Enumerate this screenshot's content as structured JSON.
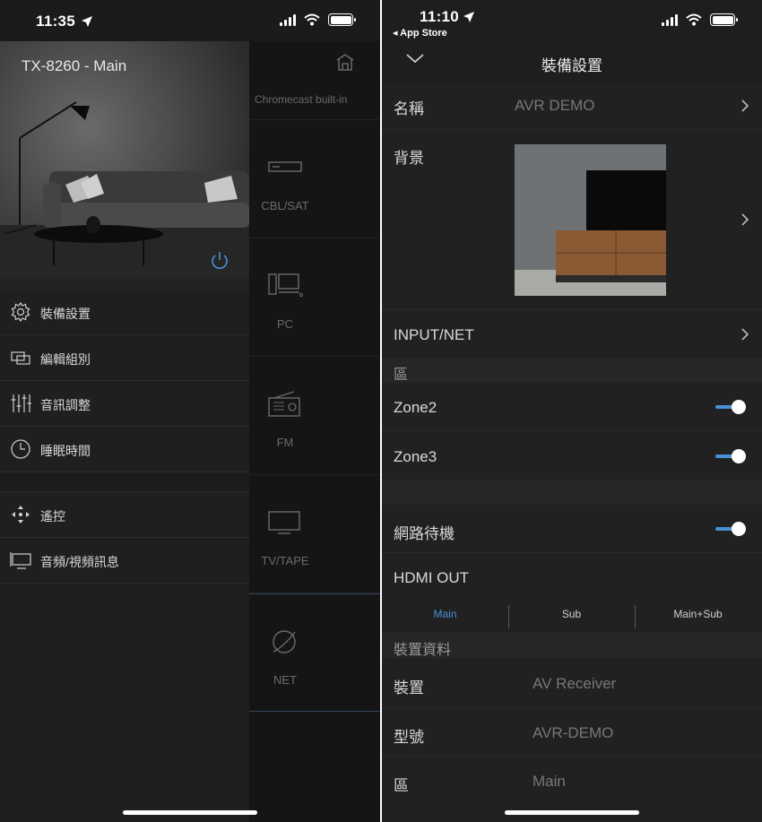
{
  "left": {
    "status": {
      "time": "11:35"
    },
    "drawer": {
      "device_title": "TX-8260 - Main",
      "menu": [
        {
          "label": "裝備設置",
          "icon": "gear-icon"
        },
        {
          "label": "編輯組別",
          "icon": "group-icon"
        },
        {
          "label": "音訊調整",
          "icon": "sliders-icon"
        },
        {
          "label": "睡眠時間",
          "icon": "clock-icon"
        },
        {
          "label": "遙控",
          "icon": "dpad-icon"
        },
        {
          "label": "音頻/視頻訊息",
          "icon": "av-info-icon"
        }
      ]
    },
    "sources_panel": {
      "chromecast": "Chromecast built-in",
      "sources": [
        {
          "label": "CBL/SAT",
          "icon": "set-top-box-icon"
        },
        {
          "label": "PC",
          "icon": "computer-icon"
        },
        {
          "label": "FM",
          "icon": "radio-icon"
        },
        {
          "label": "TV/TAPE",
          "icon": "tv-icon"
        },
        {
          "label": "NET",
          "icon": "globe-icon"
        }
      ]
    }
  },
  "right": {
    "status": {
      "time": "11:10",
      "back_app": "◂ App Store"
    },
    "nav": {
      "title": "裝備設置"
    },
    "name_row": {
      "label": "名稱",
      "value": "AVR DEMO"
    },
    "background_row": {
      "label": "背景"
    },
    "input_net_row": {
      "label": "INPUT/NET"
    },
    "zone_section": {
      "title": "區"
    },
    "zone2": {
      "label": "Zone2",
      "on": true
    },
    "zone3": {
      "label": "Zone3",
      "on": true
    },
    "network_standby": {
      "label": "網路待機",
      "on": true
    },
    "hdmi_out": {
      "label": "HDMI OUT",
      "options": [
        "Main",
        "Sub",
        "Main+Sub"
      ],
      "selected": "Main"
    },
    "device_info_section": {
      "title": "裝置資料"
    },
    "device_info": [
      {
        "label": "裝置",
        "value": "AV Receiver"
      },
      {
        "label": "型號",
        "value": "AVR-DEMO"
      },
      {
        "label": "區",
        "value": "Main"
      }
    ],
    "accent_color": "#4a90d9"
  }
}
